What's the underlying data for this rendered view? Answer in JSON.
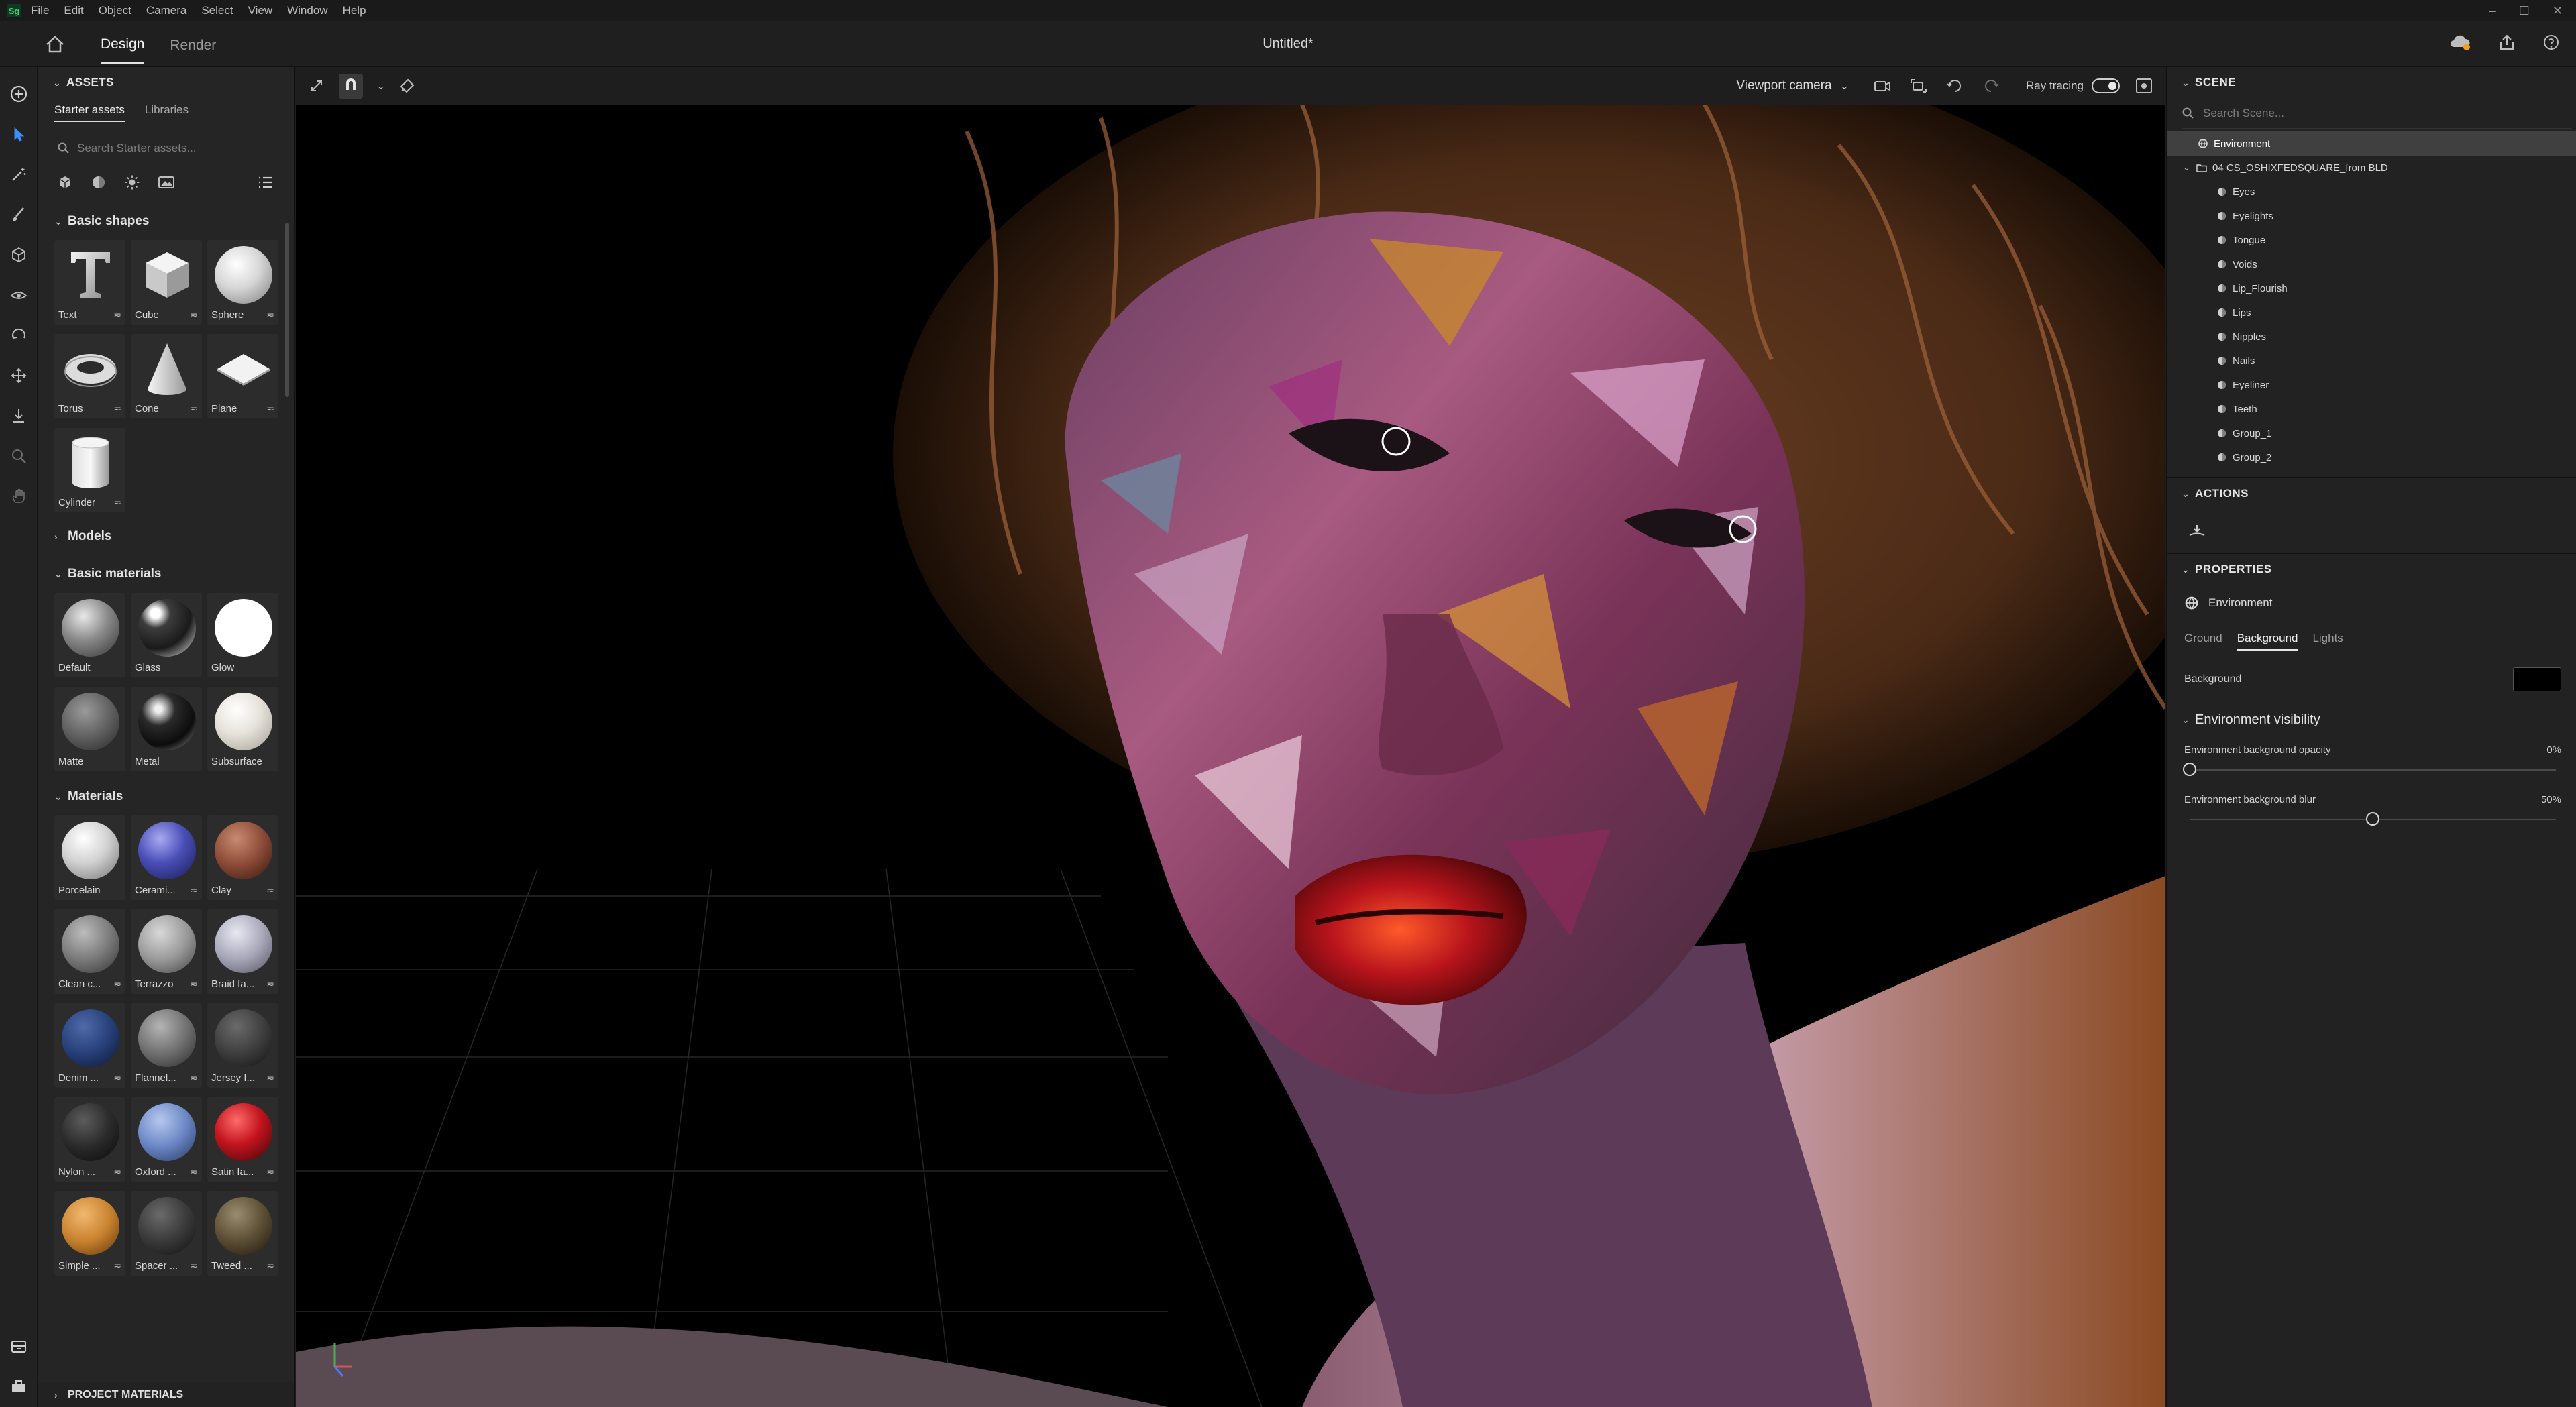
{
  "menu": {
    "logo": "Sg",
    "items": [
      "File",
      "Edit",
      "Object",
      "Camera",
      "Select",
      "View",
      "Window",
      "Help"
    ]
  },
  "titlebar": {
    "tabs": [
      "Design",
      "Render"
    ],
    "document_title": "Untitled*"
  },
  "assets": {
    "header": "ASSETS",
    "subtabs": [
      "Starter assets",
      "Libraries"
    ],
    "search_placeholder": "Search Starter assets...",
    "basic_shapes": {
      "title": "Basic shapes",
      "items": [
        "Text",
        "Cube",
        "Sphere",
        "Torus",
        "Cone",
        "Plane",
        "Cylinder"
      ]
    },
    "models_title": "Models",
    "basic_materials": {
      "title": "Basic materials",
      "items": [
        "Default",
        "Glass",
        "Glow",
        "Matte",
        "Metal",
        "Subsurface"
      ]
    },
    "materials": {
      "title": "Materials",
      "items": [
        "Porcelain",
        "Cerami...",
        "Clay",
        "Clean c...",
        "Terrazzo",
        "Braid fa...",
        "Denim ...",
        "Flannel...",
        "Jersey f...",
        "Nylon ...",
        "Oxford ...",
        "Satin fa...",
        "Simple ...",
        "Spacer ...",
        "Tweed ..."
      ]
    },
    "project_materials": "PROJECT MATERIALS"
  },
  "viewport": {
    "camera": "Viewport camera",
    "ray_tracing_label": "Ray tracing",
    "ray_tracing_on": true
  },
  "scene": {
    "header": "SCENE",
    "search_placeholder": "Search Scene...",
    "environment": "Environment",
    "group": "04 CS_OSHIXFEDSQUARE_from BLD",
    "children": [
      "Eyes",
      "Eyelights",
      "Tongue",
      "Voids",
      "Lip_Flourish",
      "Lips",
      "Nipples",
      "Nails",
      "Eyeliner",
      "Teeth",
      "Group_1",
      "Group_2"
    ]
  },
  "actions": {
    "header": "ACTIONS"
  },
  "properties": {
    "header": "PROPERTIES",
    "object": "Environment",
    "tabs": [
      "Ground",
      "Background",
      "Lights"
    ],
    "background_label": "Background",
    "background_color": "#000000",
    "env_visibility_title": "Environment visibility",
    "opacity_label": "Environment background opacity",
    "opacity_value": "0%",
    "opacity_fraction": 0.0,
    "blur_label": "Environment background blur",
    "blur_value": "50%",
    "blur_fraction": 0.5
  },
  "colors": {
    "accent": "#3f8cff",
    "panel_bg": "#252525",
    "canvas_bg": "#000000"
  }
}
